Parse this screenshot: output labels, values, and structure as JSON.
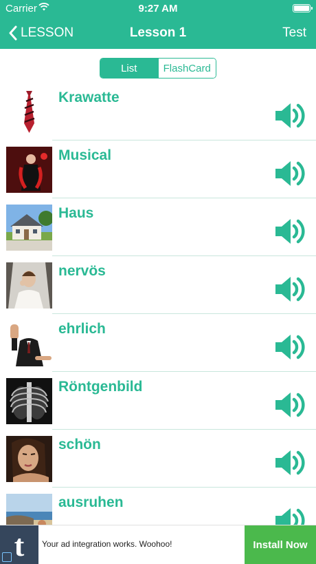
{
  "status_bar": {
    "carrier": "Carrier",
    "time": "9:27 AM"
  },
  "nav": {
    "back_label": "LESSON",
    "title": "Lesson 1",
    "test_label": "Test"
  },
  "segment": {
    "list_label": "List",
    "flashcard_label": "FlashCard",
    "selected": "List"
  },
  "words": [
    {
      "word": "Krawatte",
      "image": "necktie-photo"
    },
    {
      "word": "Musical",
      "image": "musical-performer-photo"
    },
    {
      "word": "Haus",
      "image": "house-photo"
    },
    {
      "word": "nervös",
      "image": "nervous-bride-photo"
    },
    {
      "word": "ehrlich",
      "image": "raised-hand-oath-photo"
    },
    {
      "word": "Röntgenbild",
      "image": "chest-xray-photo"
    },
    {
      "word": "schön",
      "image": "woman-portrait-photo"
    },
    {
      "word": "ausruhen",
      "image": "beach-rest-photo"
    }
  ],
  "ad": {
    "text": "Your ad integration works. Woohoo!",
    "cta": "Install Now",
    "logo_letter": "t"
  },
  "colors": {
    "accent": "#2ab994",
    "ad_button": "#4bb94c",
    "ad_logo_bg": "#35465c"
  }
}
